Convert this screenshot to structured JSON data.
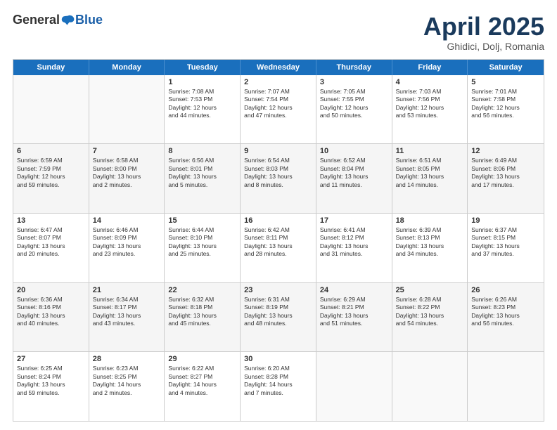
{
  "logo": {
    "general": "General",
    "blue": "Blue"
  },
  "title": "April 2025",
  "location": "Ghidici, Dolj, Romania",
  "header_days": [
    "Sunday",
    "Monday",
    "Tuesday",
    "Wednesday",
    "Thursday",
    "Friday",
    "Saturday"
  ],
  "weeks": [
    {
      "shade": false,
      "cells": [
        {
          "day": "",
          "info": ""
        },
        {
          "day": "",
          "info": ""
        },
        {
          "day": "1",
          "info": "Sunrise: 7:08 AM\nSunset: 7:53 PM\nDaylight: 12 hours\nand 44 minutes."
        },
        {
          "day": "2",
          "info": "Sunrise: 7:07 AM\nSunset: 7:54 PM\nDaylight: 12 hours\nand 47 minutes."
        },
        {
          "day": "3",
          "info": "Sunrise: 7:05 AM\nSunset: 7:55 PM\nDaylight: 12 hours\nand 50 minutes."
        },
        {
          "day": "4",
          "info": "Sunrise: 7:03 AM\nSunset: 7:56 PM\nDaylight: 12 hours\nand 53 minutes."
        },
        {
          "day": "5",
          "info": "Sunrise: 7:01 AM\nSunset: 7:58 PM\nDaylight: 12 hours\nand 56 minutes."
        }
      ]
    },
    {
      "shade": true,
      "cells": [
        {
          "day": "6",
          "info": "Sunrise: 6:59 AM\nSunset: 7:59 PM\nDaylight: 12 hours\nand 59 minutes."
        },
        {
          "day": "7",
          "info": "Sunrise: 6:58 AM\nSunset: 8:00 PM\nDaylight: 13 hours\nand 2 minutes."
        },
        {
          "day": "8",
          "info": "Sunrise: 6:56 AM\nSunset: 8:01 PM\nDaylight: 13 hours\nand 5 minutes."
        },
        {
          "day": "9",
          "info": "Sunrise: 6:54 AM\nSunset: 8:03 PM\nDaylight: 13 hours\nand 8 minutes."
        },
        {
          "day": "10",
          "info": "Sunrise: 6:52 AM\nSunset: 8:04 PM\nDaylight: 13 hours\nand 11 minutes."
        },
        {
          "day": "11",
          "info": "Sunrise: 6:51 AM\nSunset: 8:05 PM\nDaylight: 13 hours\nand 14 minutes."
        },
        {
          "day": "12",
          "info": "Sunrise: 6:49 AM\nSunset: 8:06 PM\nDaylight: 13 hours\nand 17 minutes."
        }
      ]
    },
    {
      "shade": false,
      "cells": [
        {
          "day": "13",
          "info": "Sunrise: 6:47 AM\nSunset: 8:07 PM\nDaylight: 13 hours\nand 20 minutes."
        },
        {
          "day": "14",
          "info": "Sunrise: 6:46 AM\nSunset: 8:09 PM\nDaylight: 13 hours\nand 23 minutes."
        },
        {
          "day": "15",
          "info": "Sunrise: 6:44 AM\nSunset: 8:10 PM\nDaylight: 13 hours\nand 25 minutes."
        },
        {
          "day": "16",
          "info": "Sunrise: 6:42 AM\nSunset: 8:11 PM\nDaylight: 13 hours\nand 28 minutes."
        },
        {
          "day": "17",
          "info": "Sunrise: 6:41 AM\nSunset: 8:12 PM\nDaylight: 13 hours\nand 31 minutes."
        },
        {
          "day": "18",
          "info": "Sunrise: 6:39 AM\nSunset: 8:13 PM\nDaylight: 13 hours\nand 34 minutes."
        },
        {
          "day": "19",
          "info": "Sunrise: 6:37 AM\nSunset: 8:15 PM\nDaylight: 13 hours\nand 37 minutes."
        }
      ]
    },
    {
      "shade": true,
      "cells": [
        {
          "day": "20",
          "info": "Sunrise: 6:36 AM\nSunset: 8:16 PM\nDaylight: 13 hours\nand 40 minutes."
        },
        {
          "day": "21",
          "info": "Sunrise: 6:34 AM\nSunset: 8:17 PM\nDaylight: 13 hours\nand 43 minutes."
        },
        {
          "day": "22",
          "info": "Sunrise: 6:32 AM\nSunset: 8:18 PM\nDaylight: 13 hours\nand 45 minutes."
        },
        {
          "day": "23",
          "info": "Sunrise: 6:31 AM\nSunset: 8:19 PM\nDaylight: 13 hours\nand 48 minutes."
        },
        {
          "day": "24",
          "info": "Sunrise: 6:29 AM\nSunset: 8:21 PM\nDaylight: 13 hours\nand 51 minutes."
        },
        {
          "day": "25",
          "info": "Sunrise: 6:28 AM\nSunset: 8:22 PM\nDaylight: 13 hours\nand 54 minutes."
        },
        {
          "day": "26",
          "info": "Sunrise: 6:26 AM\nSunset: 8:23 PM\nDaylight: 13 hours\nand 56 minutes."
        }
      ]
    },
    {
      "shade": false,
      "cells": [
        {
          "day": "27",
          "info": "Sunrise: 6:25 AM\nSunset: 8:24 PM\nDaylight: 13 hours\nand 59 minutes."
        },
        {
          "day": "28",
          "info": "Sunrise: 6:23 AM\nSunset: 8:25 PM\nDaylight: 14 hours\nand 2 minutes."
        },
        {
          "day": "29",
          "info": "Sunrise: 6:22 AM\nSunset: 8:27 PM\nDaylight: 14 hours\nand 4 minutes."
        },
        {
          "day": "30",
          "info": "Sunrise: 6:20 AM\nSunset: 8:28 PM\nDaylight: 14 hours\nand 7 minutes."
        },
        {
          "day": "",
          "info": ""
        },
        {
          "day": "",
          "info": ""
        },
        {
          "day": "",
          "info": ""
        }
      ]
    }
  ]
}
